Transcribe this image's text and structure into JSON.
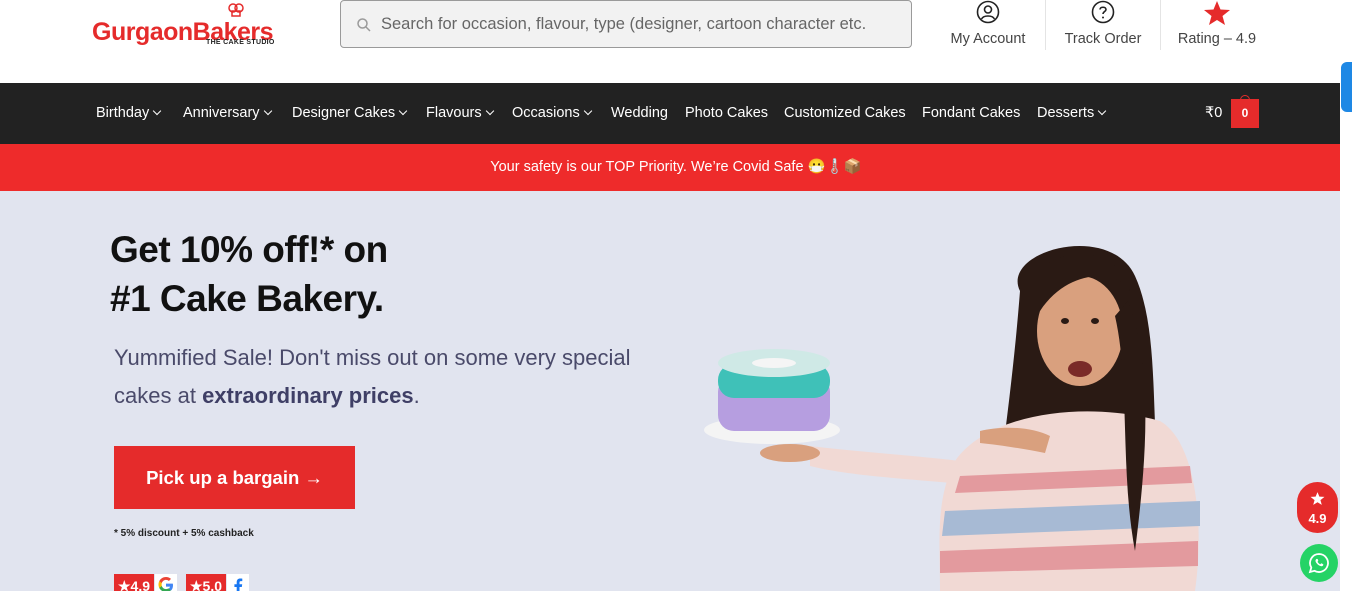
{
  "brand": {
    "name": "GurgaonBakers",
    "tagline": "THE CAKE STUDIO"
  },
  "search": {
    "placeholder": "Search for occasion, flavour, type (designer, cartoon character etc."
  },
  "header_links": {
    "account": "My Account",
    "track": "Track Order",
    "rating": "Rating – 4.9"
  },
  "nav": {
    "items": [
      {
        "label": "Birthday",
        "has_dropdown": true
      },
      {
        "label": "Anniversary",
        "has_dropdown": true
      },
      {
        "label": "Designer Cakes",
        "has_dropdown": true
      },
      {
        "label": "Flavours",
        "has_dropdown": true
      },
      {
        "label": "Occasions",
        "has_dropdown": true
      },
      {
        "label": "Wedding",
        "has_dropdown": false
      },
      {
        "label": "Photo Cakes",
        "has_dropdown": false
      },
      {
        "label": "Customized Cakes",
        "has_dropdown": false
      },
      {
        "label": "Fondant Cakes",
        "has_dropdown": false
      },
      {
        "label": "Desserts",
        "has_dropdown": true
      }
    ],
    "cart_total": "₹0",
    "cart_count": "0"
  },
  "promo": {
    "text": "Your safety is our TOP Priority. We’re Covid Safe 😷🌡️📦"
  },
  "hero": {
    "title_line1": "Get 10% off!* on",
    "title_line2": "#1 Cake Bakery.",
    "subtitle_start": "Yummified Sale! Don't miss out on some very special cakes at",
    "subtitle_bold": "extraordinary prices",
    "subtitle_end": ".",
    "cta_label": "Pick up a bargain →",
    "footnote": "* 5% discount + 5% cashback",
    "badges": [
      {
        "rating": "★4.9",
        "source_icon": "google-icon"
      },
      {
        "rating": "★5.0",
        "source_icon": "facebook-icon"
      }
    ]
  },
  "floating": {
    "rating": "4.9",
    "whatsapp_icon": "whatsapp-icon"
  },
  "colors": {
    "brand_red": "#e52b2b",
    "nav_bg": "#222222",
    "promo_bg": "#ee2b2b",
    "hero_bg": "#e1e4ef",
    "whatsapp": "#25d366"
  }
}
